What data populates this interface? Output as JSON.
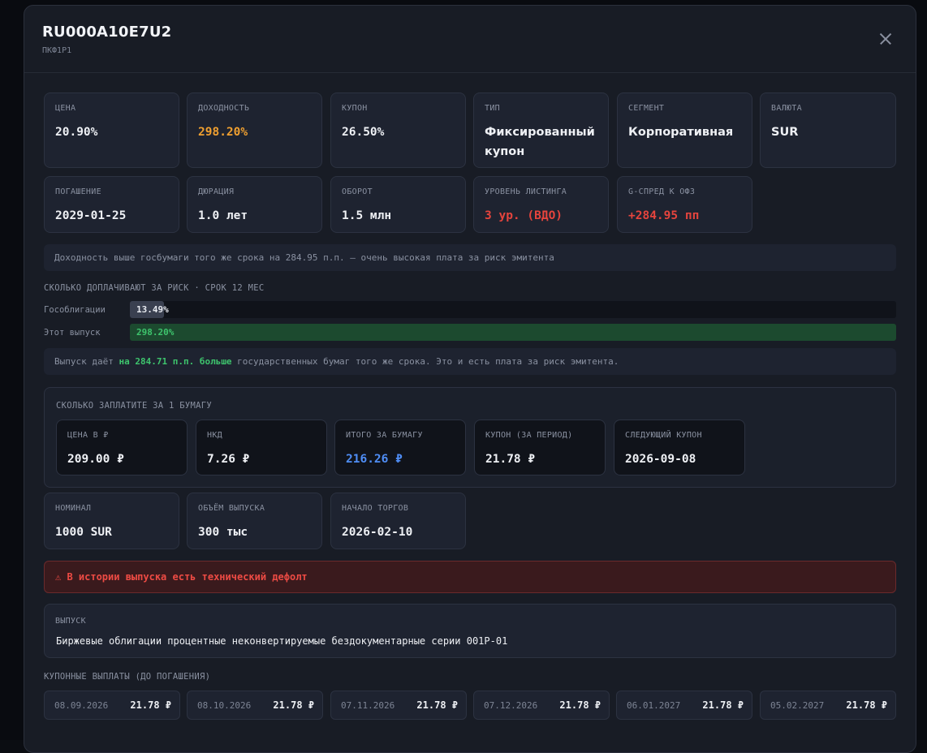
{
  "header": {
    "title": "RU000A10E7U2",
    "subtitle": "ПКФ1Р1"
  },
  "metrics_row1": [
    {
      "label": "ЦЕНА",
      "value": "20.90%"
    },
    {
      "label": "ДОХОДНОСТЬ",
      "value": "298.20%"
    },
    {
      "label": "КУПОН",
      "value": "26.50%"
    },
    {
      "label": "ТИП",
      "value": "Фиксированный купон"
    },
    {
      "label": "СЕГМЕНТ",
      "value": "Корпоративная"
    },
    {
      "label": "ВАЛЮТА",
      "value": "SUR"
    }
  ],
  "metrics_row2": [
    {
      "label": "ПОГАШЕНИЕ",
      "value": "2029-01-25"
    },
    {
      "label": "ДЮРАЦИЯ",
      "value": "1.0 лет"
    },
    {
      "label": "ОБОРОТ",
      "value": "1.5 млн"
    },
    {
      "label": "УРОВЕНЬ ЛИСТИНГА",
      "value": "3 ур. (ВДО)"
    },
    {
      "label": "G-СПРЕД К ОФЗ",
      "value": "+284.95 пп"
    }
  ],
  "spread_note": "Доходность выше госбумаги того же срока на 284.95 п.п. — очень высокая плата за риск эмитента",
  "risk": {
    "title": "СКОЛЬКО ДОПЛАЧИВАЮТ ЗА РИСК · СРОК 12 МЕС",
    "bars": [
      {
        "label": "Гособлигации",
        "value": "13.49%",
        "fraction": 0.045
      },
      {
        "label": "Этот выпуск",
        "value": "298.20%",
        "fraction": 1.0
      }
    ],
    "note_prefix": "Выпуск даёт ",
    "note_highlight": "на 284.71 п.п. больше",
    "note_suffix": " государственных бумаг того же срока. Это и есть плата за риск эмитента."
  },
  "payment": {
    "title": "СКОЛЬКО ЗАПЛАТИТЕ ЗА 1 БУМАГУ",
    "items": [
      {
        "label": "ЦЕНА В ₽",
        "value": "209.00 ₽"
      },
      {
        "label": "НКД",
        "value": "7.26 ₽"
      },
      {
        "label": "ИТОГО ЗА БУМАГУ",
        "value": "216.26 ₽"
      },
      {
        "label": "КУПОН (ЗА ПЕРИОД)",
        "value": "21.78 ₽"
      },
      {
        "label": "СЛЕДУЮЩИЙ КУПОН",
        "value": "2026-09-08"
      }
    ]
  },
  "metrics_row3": [
    {
      "label": "НОМИНАЛ",
      "value": "1000 SUR"
    },
    {
      "label": "ОБЪЁМ ВЫПУСКА",
      "value": "300 тыс"
    },
    {
      "label": "НАЧАЛО ТОРГОВ",
      "value": "2026-02-10"
    }
  ],
  "alert": "⚠ В истории выпуска есть технический дефолт",
  "issue": {
    "label": "ВЫПУСК",
    "value": "Биржевые облигации процентные неконвертируемые бездокументарные серии 001P-01"
  },
  "coupons": {
    "title": "КУПОННЫЕ ВЫПЛАТЫ (ДО ПОГАШЕНИЯ)",
    "items": [
      {
        "date": "08.09.2026",
        "amount": "21.78 ₽"
      },
      {
        "date": "08.10.2026",
        "amount": "21.78 ₽"
      },
      {
        "date": "07.11.2026",
        "amount": "21.78 ₽"
      },
      {
        "date": "07.12.2026",
        "amount": "21.78 ₽"
      },
      {
        "date": "06.01.2027",
        "amount": "21.78 ₽"
      },
      {
        "date": "05.02.2027",
        "amount": "21.78 ₽"
      }
    ]
  },
  "colors": {
    "accent_orange": "#f0a030",
    "danger": "#e5443d",
    "positive": "#3ec46d",
    "link_blue": "#4f8ef7"
  }
}
